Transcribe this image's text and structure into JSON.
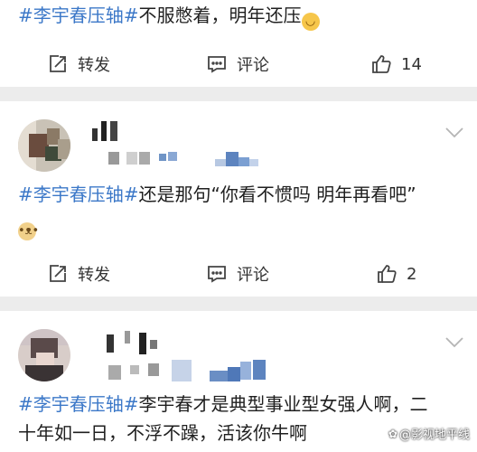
{
  "posts": [
    {
      "hashtag": "#李宇春压轴#",
      "text": "不服憋着，明年还压",
      "emoji": "smile-emoji",
      "repost_label": "转发",
      "comment_label": "评论",
      "like_count": "14"
    },
    {
      "hashtag": "#李宇春压轴#",
      "text": "还是那句“你看不惯吗 明年再看吧”",
      "emoji": "doge-emoji",
      "repost_label": "转发",
      "comment_label": "评论",
      "like_count": "2"
    },
    {
      "hashtag": "#李宇春压轴#",
      "text_line1": "李宇春才是典型事业型女强人啊，二",
      "text_line2": "十年如一日，不浮不躁，活该你牛啊"
    }
  ],
  "watermark": "@影视地平线",
  "icons": [
    "repost-icon",
    "comment-icon",
    "like-icon",
    "chevron-down-icon"
  ],
  "colors": {
    "hashtag": "#3c78c8",
    "background": "#ececec",
    "card": "#ffffff"
  }
}
